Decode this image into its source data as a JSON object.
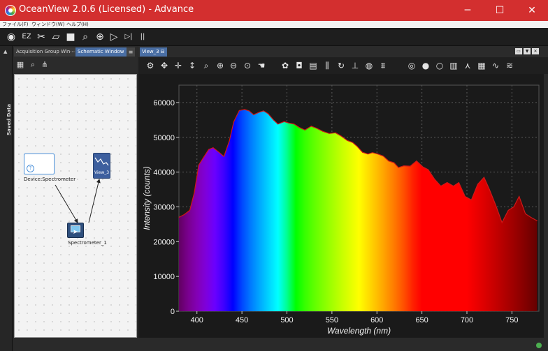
{
  "window": {
    "title": "OceanView 2.0.6 (Licensed) - Advance",
    "minimize": "─",
    "maximize": "☐",
    "close": "✕"
  },
  "menu": [
    "ファイル(F)",
    "ウィンドウ(W)",
    "ヘルプ(H)"
  ],
  "toolbar": [
    {
      "icon": "ocean-logo-icon",
      "glyph": "◉"
    },
    {
      "icon": "ez-icon",
      "glyph": "EZ"
    },
    {
      "icon": "tools-icon",
      "glyph": "✂"
    },
    {
      "icon": "open-folder-icon",
      "glyph": "▱"
    },
    {
      "icon": "save-icon",
      "glyph": "■"
    },
    {
      "icon": "search-icon",
      "glyph": "⌕"
    },
    {
      "icon": "globe-icon",
      "glyph": "⊕"
    },
    {
      "icon": "play-icon",
      "glyph": "▷"
    },
    {
      "icon": "step-icon",
      "glyph": "▷|"
    },
    {
      "icon": "pause-icon",
      "glyph": "||"
    }
  ],
  "saved_data": {
    "label": "Saved Data",
    "pin": "▲"
  },
  "left_tabs": [
    {
      "label": "Acquisition Group Win⋯",
      "active": false
    },
    {
      "label": "Schematic Window",
      "active": true
    }
  ],
  "left_tab_menu": "≡",
  "schematic_tools": [
    {
      "icon": "grid-icon",
      "glyph": "▦"
    },
    {
      "icon": "zoom-icon",
      "glyph": "⌕"
    },
    {
      "icon": "share-icon",
      "glyph": "⋔"
    }
  ],
  "schematic": {
    "device_label": "Device:Spectrometer",
    "device_q": "?",
    "view_label": "View_3",
    "spectrometer_label": "Spectrometer_1"
  },
  "view_tab": {
    "label": "View_3 ⊟",
    "controls": [
      "▭",
      "▼",
      "✕"
    ]
  },
  "chart_tools": [
    {
      "icon": "settings-icon",
      "glyph": "⚙"
    },
    {
      "icon": "pan-icon",
      "glyph": "✥"
    },
    {
      "icon": "move-horizontal-icon",
      "glyph": "✛"
    },
    {
      "icon": "move-vertical-icon",
      "glyph": "↕"
    },
    {
      "icon": "zoom-icon",
      "glyph": "⌕"
    },
    {
      "icon": "zoom-in-icon",
      "glyph": "⊕"
    },
    {
      "icon": "zoom-out-icon",
      "glyph": "⊖"
    },
    {
      "icon": "zoom-fit-icon",
      "glyph": "⊙"
    },
    {
      "icon": "hand-icon",
      "glyph": "☚"
    },
    {
      "icon": "palette-icon",
      "glyph": "✿"
    },
    {
      "icon": "camera-icon",
      "glyph": "◘"
    },
    {
      "icon": "spectrum-icon",
      "glyph": "▤"
    },
    {
      "icon": "mixer-icon",
      "glyph": "⫼"
    },
    {
      "icon": "refresh-icon",
      "glyph": "↻"
    },
    {
      "icon": "baseline-icon",
      "glyph": "⊥"
    },
    {
      "icon": "color-wheel-icon",
      "glyph": "◍"
    },
    {
      "icon": "filter-icon",
      "glyph": "⩩"
    },
    {
      "icon": "globe-icon",
      "glyph": "◎"
    },
    {
      "icon": "lamp-on-icon",
      "glyph": "●"
    },
    {
      "icon": "lamp-off-icon",
      "glyph": "○"
    },
    {
      "icon": "bar-chart-icon",
      "glyph": "▥"
    },
    {
      "icon": "peak-icon",
      "glyph": "⋏"
    },
    {
      "icon": "table-icon",
      "glyph": "▦"
    },
    {
      "icon": "wave-icon",
      "glyph": "∿"
    },
    {
      "icon": "wave-list-icon",
      "glyph": "≋"
    }
  ],
  "chart_data": {
    "type": "area",
    "title": "",
    "xlabel": "Wavelength (nm)",
    "ylabel": "Intensity (counts)",
    "xlim": [
      380,
      780
    ],
    "ylim": [
      0,
      65000
    ],
    "xticks": [
      400,
      450,
      500,
      550,
      600,
      650,
      700,
      750
    ],
    "yticks": [
      0,
      10000,
      20000,
      30000,
      40000,
      50000,
      60000
    ],
    "grid": true,
    "fill": "visible-spectrum gradient by wavelength",
    "x": [
      380,
      386,
      392,
      397,
      402,
      408,
      413,
      418,
      423,
      430,
      436,
      441,
      447,
      453,
      458,
      463,
      469,
      474,
      479,
      485,
      490,
      497,
      502,
      508,
      514,
      520,
      527,
      533,
      540,
      547,
      554,
      560,
      567,
      573,
      578,
      584,
      590,
      595,
      601,
      607,
      613,
      619,
      624,
      630,
      637,
      644,
      651,
      657,
      664,
      671,
      678,
      685,
      691,
      698,
      705,
      712,
      719,
      725,
      732,
      739,
      746,
      752,
      758,
      765,
      771,
      778
    ],
    "values": [
      27000,
      27800,
      29000,
      34000,
      42000,
      44500,
      46500,
      47000,
      46000,
      44500,
      49000,
      54500,
      57700,
      58000,
      57600,
      56500,
      57200,
      57600,
      56800,
      55000,
      53800,
      54500,
      54100,
      53800,
      52800,
      52100,
      53200,
      52600,
      51700,
      51100,
      51300,
      50400,
      49100,
      48500,
      47400,
      45700,
      45200,
      45600,
      45200,
      44600,
      43200,
      42700,
      41300,
      41800,
      41700,
      43200,
      41500,
      40700,
      38000,
      36000,
      37000,
      36000,
      37000,
      33000,
      32000,
      36500,
      38500,
      35000,
      30500,
      25500,
      29000,
      30000,
      33000,
      28000,
      27000,
      26000
    ]
  }
}
